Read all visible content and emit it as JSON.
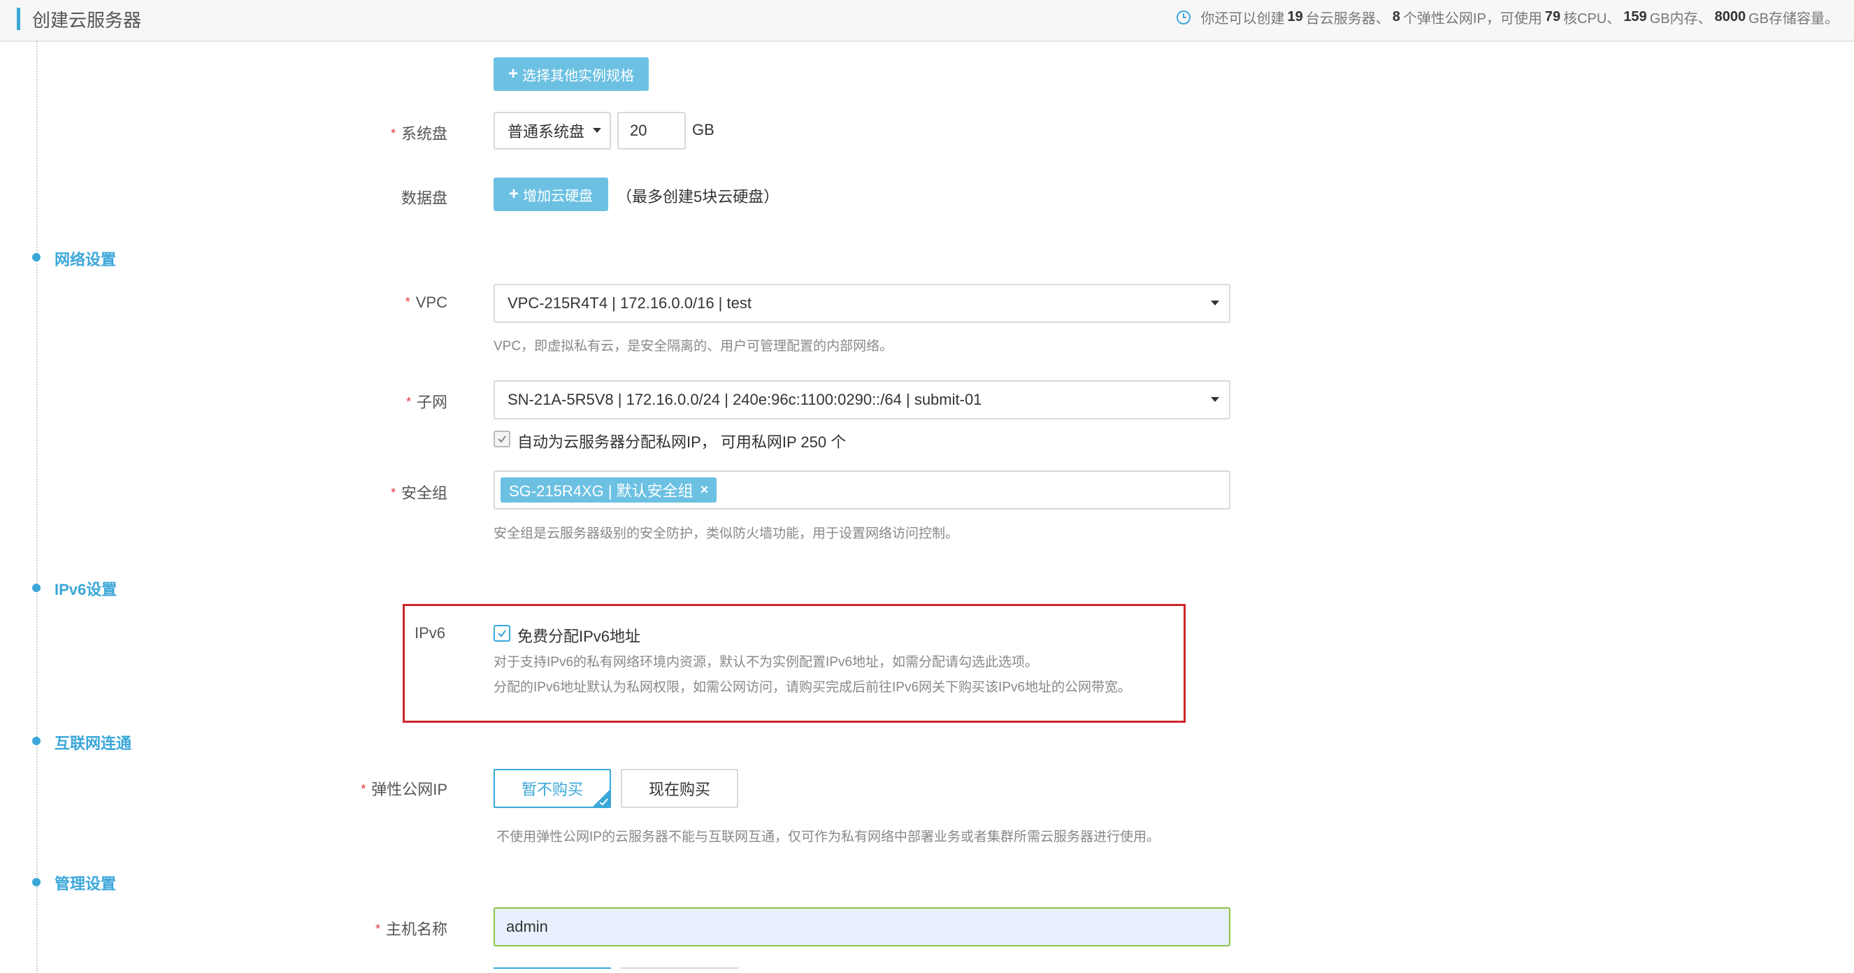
{
  "header": {
    "title": "创建云服务器",
    "quota": {
      "prefix": "你还可以创建",
      "servers": "19",
      "servers_unit": "台云服务器、",
      "eips": "8",
      "eips_unit": "个弹性公网IP，可使用",
      "cpu": "79",
      "cpu_unit": "核CPU、",
      "mem": "159",
      "mem_unit": "GB内存、",
      "storage": "8000",
      "storage_unit": "GB存储容量。"
    }
  },
  "instance": {
    "other_spec_button": "选择其他实例规格"
  },
  "system_disk": {
    "label": "系统盘",
    "type": "普通系统盘",
    "size": "20",
    "unit": "GB"
  },
  "data_disk": {
    "label": "数据盘",
    "add_button": "增加云硬盘",
    "hint": "（最多创建5块云硬盘）"
  },
  "sections": {
    "network": "网络设置",
    "ipv6": "IPv6设置",
    "internet": "互联网连通",
    "management": "管理设置"
  },
  "vpc": {
    "label": "VPC",
    "value": "VPC-215R4T4 | 172.16.0.0/16 | test",
    "help": "VPC，即虚拟私有云，是安全隔离的、用户可管理配置的内部网络。"
  },
  "subnet": {
    "label": "子网",
    "value": "SN-21A-5R5V8 | 172.16.0.0/24 | 240e:96c:1100:0290::/64 | submit-01",
    "auto_ip_label": "自动为云服务器分配私网IP， 可用私网IP 250 个",
    "auto_ip_checked": true
  },
  "security_group": {
    "label": "安全组",
    "tag": "SG-215R4XG | 默认安全组",
    "help": "安全组是云服务器级别的安全防护，类似防火墙功能，用于设置网络访问控制。"
  },
  "ipv6": {
    "label": "IPv6",
    "checkbox_label": "免费分配IPv6地址",
    "checked": true,
    "help_line1": "对于支持IPv6的私有网络环境内资源，默认不为实例配置IPv6地址，如需分配请勾选此选项。",
    "help_line2": "分配的IPv6地址默认为私网权限，如需公网访问，请购买完成后前往IPv6网关下购买该IPv6地址的公网带宽。"
  },
  "eip": {
    "label": "弹性公网IP",
    "options": [
      "暂不购买",
      "现在购买"
    ],
    "selected": "暂不购买",
    "help": "不使用弹性公网IP的云服务器不能与互联网互通，仅可作为私有网络中部署业务或者集群所需云服务器进行使用。"
  },
  "hostname": {
    "label": "主机名称",
    "value": "admin"
  },
  "colors": {
    "accent": "#3ba7d9",
    "button": "#6cc1e3",
    "required": "#e4393c",
    "highlight": "#d0252b"
  }
}
